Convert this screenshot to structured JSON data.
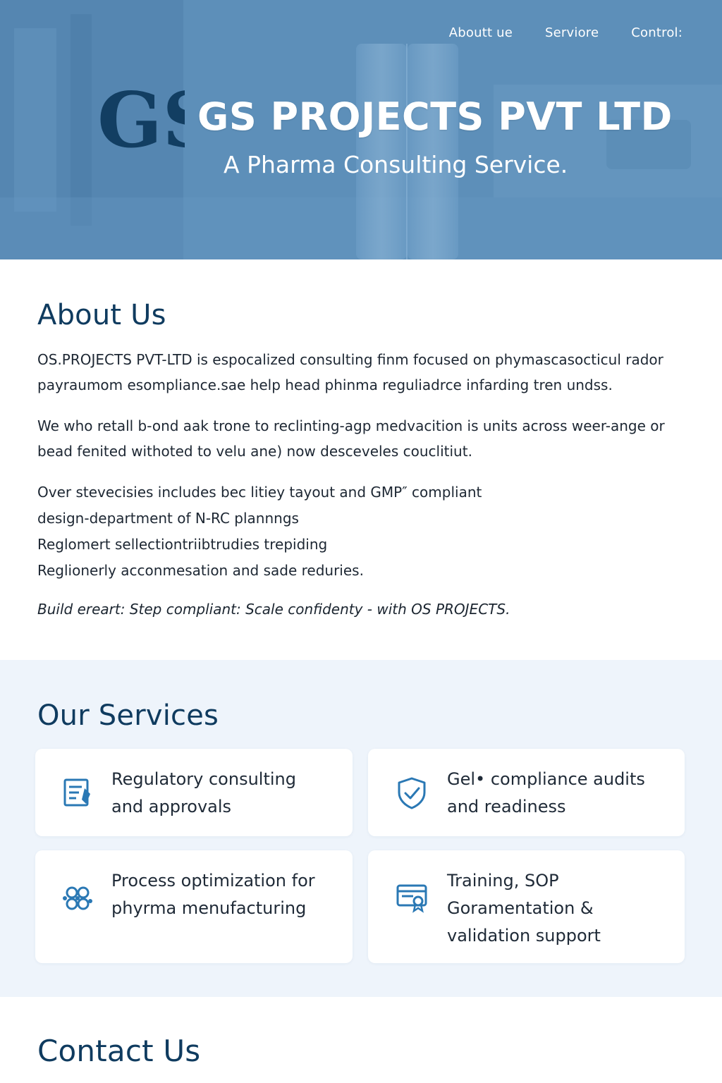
{
  "nav": {
    "items": [
      {
        "label": "Aboutt ue"
      },
      {
        "label": "Serviore"
      },
      {
        "label": "Control:"
      }
    ]
  },
  "hero": {
    "logo_text": "GS",
    "title": "GS PROJECTS PVT LTD",
    "tagline": "A Pharma Consulting Service."
  },
  "about": {
    "heading": "About Us",
    "paragraph1": "OS.PROJECTS PVT-LTD is espocalized consulting finm focused on phymascasocticul rador payraumom esompliance.sae help head phinma reguliadrce infarding tren undss.",
    "paragraph2": "We who retall b-ond aak trone to reclinting-agp medvacition is units across weer-ange or bead fenited withoted to velu ane) now desceveles couclitiut.",
    "list": [
      "Over stevecisies includes bec litiey tayout and GMP″ compliant",
      "design-department of N-RC plannngs",
      "Reglomert sellectiontriibtrudies trepiding",
      "Reglionerly acconmesation and sade reduries."
    ],
    "slogan": "Build ereart: Step compliant: Scale confidenty - with OS PROJECTS."
  },
  "services": {
    "heading": "Our Services",
    "items": [
      {
        "label": "Regulatory consulting and approvals",
        "icon": "document-icon"
      },
      {
        "label": "Gel• compliance audits and readiness",
        "icon": "shield-check-icon"
      },
      {
        "label": "Process optimization for phyrma menufacturing",
        "icon": "molecule-icon"
      },
      {
        "label": "Training, SOP Goramentation & validation support",
        "icon": "certificate-icon"
      }
    ]
  },
  "contact": {
    "heading": "Contact Us"
  },
  "colors": {
    "hero_blue": "#5f91bb",
    "heading_navy": "#0f3b5f",
    "logo_navy": "#123e62",
    "icon_blue": "#2a78b4",
    "services_bg": "#eef4fb"
  }
}
